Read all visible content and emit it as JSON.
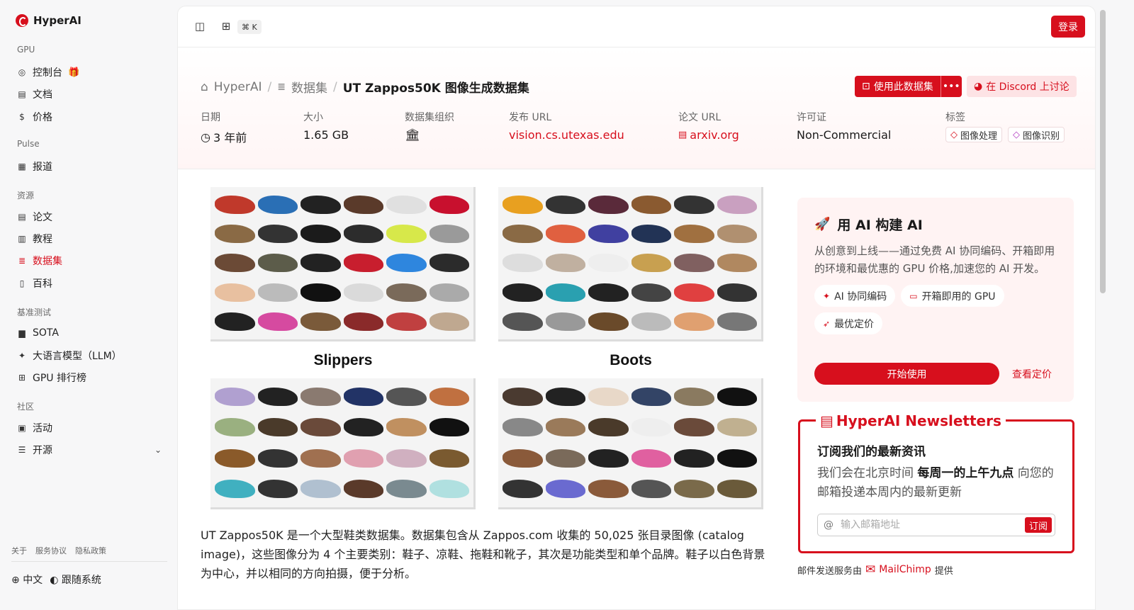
{
  "app": {
    "name": "HyperAI"
  },
  "sidebar": {
    "sections": {
      "gpu": "GPU",
      "pulse": "Pulse",
      "resources": "资源",
      "benchmarks": "基准测试",
      "community": "社区"
    },
    "items": {
      "console": "控制台",
      "docs": "文档",
      "pricing": "价格",
      "news": "报道",
      "papers": "论文",
      "tutorials": "教程",
      "datasets": "数据集",
      "wiki": "百科",
      "sota": "SOTA",
      "llm": "大语言模型（LLM）",
      "gpu_leaderboard": "GPU 排行榜",
      "events": "活动",
      "opensource": "开源"
    },
    "footer": {
      "about": "关于",
      "terms": "服务协议",
      "privacy": "隐私政策",
      "language": "中文",
      "theme": "跟随系统"
    }
  },
  "topbar": {
    "shortcut": "⌘ K",
    "login": "登录"
  },
  "breadcrumb": {
    "root": "HyperAI",
    "section": "数据集",
    "current": "UT Zappos50K 图像生成数据集"
  },
  "actions": {
    "use_dataset": "使用此数据集",
    "discord": "在 Discord 上讨论"
  },
  "meta": {
    "date_label": "日期",
    "date_value": "3 年前",
    "size_label": "大小",
    "size_value": "1.65 GB",
    "org_label": "数据集组织",
    "release_label": "发布 URL",
    "release_value": "vision.cs.utexas.edu",
    "paper_label": "论文 URL",
    "paper_value": "arxiv.org",
    "license_label": "许可证",
    "license_value": "Non-Commercial",
    "tags_label": "标签",
    "tag1": "图像处理",
    "tag2": "图像识别"
  },
  "mosaic": {
    "label_left": "Slippers",
    "label_right": "Boots"
  },
  "description": "UT Zappos50K 是一个大型鞋类数据集。数据集包含从 Zappos.com 收集的 50,025 张目录图像 (catalog image)，这些图像分为 4 个主要类别：鞋子、凉鞋、拖鞋和靴子，其次是功能类型和单个品牌。鞋子以白色背景为中心，并以相同的方向拍摄，便于分析。",
  "ai_card": {
    "title": "用 AI 构建 AI",
    "text": "从创意到上线——通过免费 AI 协同编码、开箱即用的环境和最优惠的 GPU 价格,加速您的 AI 开发。",
    "chip1": "AI 协同编码",
    "chip2": "开箱即用的 GPU",
    "chip3": "最优定价",
    "start": "开始使用",
    "pricing": "查看定价"
  },
  "newsletter": {
    "title": "HyperAI Newsletters",
    "subtitle": "订阅我们的最新资讯",
    "text_pre": "我们会在北京时间 ",
    "text_bold": "每周一的上午九点",
    "text_post": " 向您的邮箱投递本周内的最新更新",
    "placeholder": "输入邮箱地址",
    "subscribe": "订阅",
    "credit_pre": "邮件发送服务由",
    "credit_brand": "MailChimp",
    "credit_post": "提供"
  },
  "colors": {
    "accent": "#d70f1d",
    "accent_soft": "#fde3e5"
  }
}
